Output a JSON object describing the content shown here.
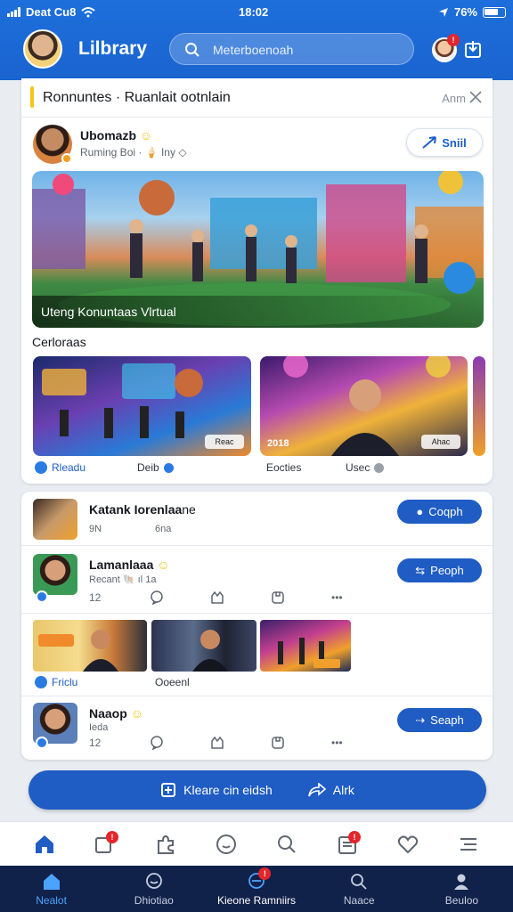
{
  "status": {
    "carrier": "Deat Cu8",
    "time": "18:02",
    "battery": "76%"
  },
  "header": {
    "title": "Lilbrary",
    "search_placeholder": "Meterboenoah"
  },
  "community": {
    "title": "Ronnuntes · Ruanlait ootnlain",
    "action": "Anm",
    "post": {
      "author": "Ubomazb",
      "meta": "Ruming Boi · 🍦 Iny",
      "send_label": "Sniil"
    },
    "hero_caption": "Uteng Konuntaas Vlrtual",
    "section_label": "Cerloraas",
    "thumbs": [
      {
        "tag": "Reac",
        "footer": "Rleadu",
        "footer2": "Deib"
      },
      {
        "tag_left": "2018",
        "tag": "Ahac",
        "footer": "Eocties",
        "footer2": "Usec"
      }
    ]
  },
  "list": {
    "rows": [
      {
        "name": "Katank Iorenlaa",
        "suffix": "ne",
        "sub1": "9N",
        "sub2": "6na",
        "button": "Coqph"
      },
      {
        "name": "Lamanlaaa",
        "sub1": "Recant 🐚 ıl 1a",
        "button": "Peoph",
        "stats": [
          "12",
          "",
          "",
          "",
          "•••"
        ]
      },
      {
        "name": "Naaop",
        "sub1": "Ieda",
        "button": "Seaph",
        "stats": [
          "12",
          "",
          "",
          "",
          "•••"
        ]
      }
    ],
    "tiles": [
      "Friclu",
      "Ooeenl"
    ]
  },
  "cta": {
    "left_label": "Kleare cin eidsh",
    "right_label": "Alrk"
  },
  "nav": [
    {
      "label": "Nealot",
      "icon": "home-icon",
      "active": true
    },
    {
      "label": "Dhiotiao",
      "icon": "chat-icon",
      "active": false
    },
    {
      "label": "Kieone Ramniirs",
      "icon": "community-icon",
      "active": false
    },
    {
      "label": "Naace",
      "icon": "search-icon",
      "active": false
    },
    {
      "label": "Beuloo",
      "icon": "profile-icon",
      "active": false
    }
  ],
  "colors": {
    "primary": "#1a64cf",
    "button": "#1f5cc4",
    "nav_bg": "#10214a",
    "badge": "#e3262b",
    "accent": "#f5c518"
  }
}
